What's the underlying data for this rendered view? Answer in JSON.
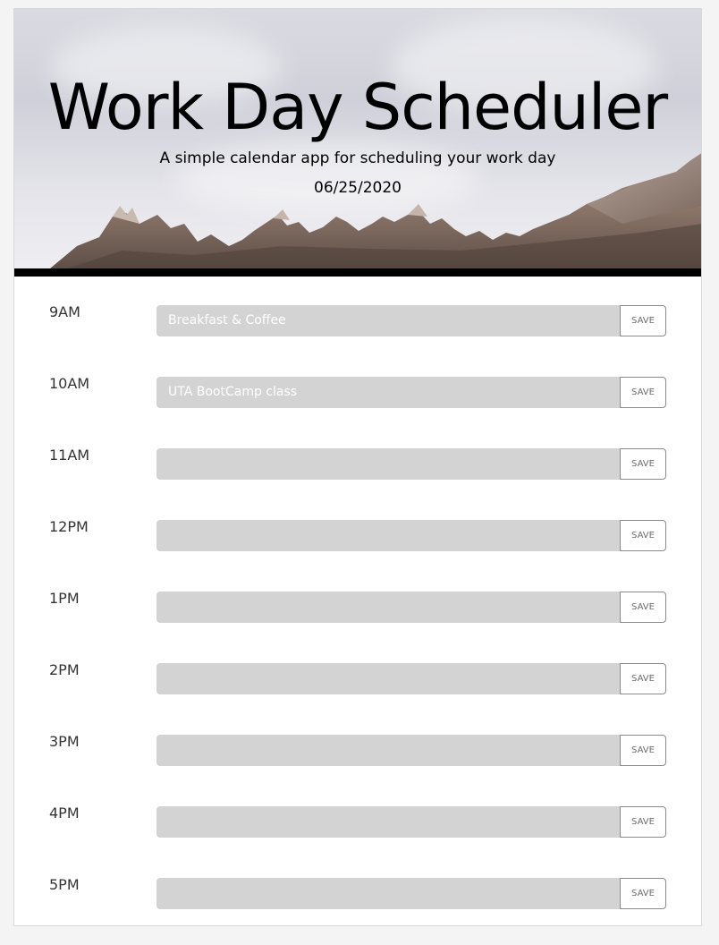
{
  "header": {
    "title": "Work Day Scheduler",
    "subtitle": "A simple calendar app for scheduling your work day",
    "date": "06/25/2020"
  },
  "colors": {
    "task_background": "#d3d3d3",
    "divider": "#000000"
  },
  "rows": [
    {
      "hour": "9AM",
      "task": "Breakfast & Coffee",
      "save_label": "SAVE"
    },
    {
      "hour": "10AM",
      "task": "UTA BootCamp class",
      "save_label": "SAVE"
    },
    {
      "hour": "11AM",
      "task": "",
      "save_label": "SAVE"
    },
    {
      "hour": "12PM",
      "task": "",
      "save_label": "SAVE"
    },
    {
      "hour": "1PM",
      "task": "",
      "save_label": "SAVE"
    },
    {
      "hour": "2PM",
      "task": "",
      "save_label": "SAVE"
    },
    {
      "hour": "3PM",
      "task": "",
      "save_label": "SAVE"
    },
    {
      "hour": "4PM",
      "task": "",
      "save_label": "SAVE"
    },
    {
      "hour": "5PM",
      "task": "",
      "save_label": "SAVE"
    }
  ]
}
